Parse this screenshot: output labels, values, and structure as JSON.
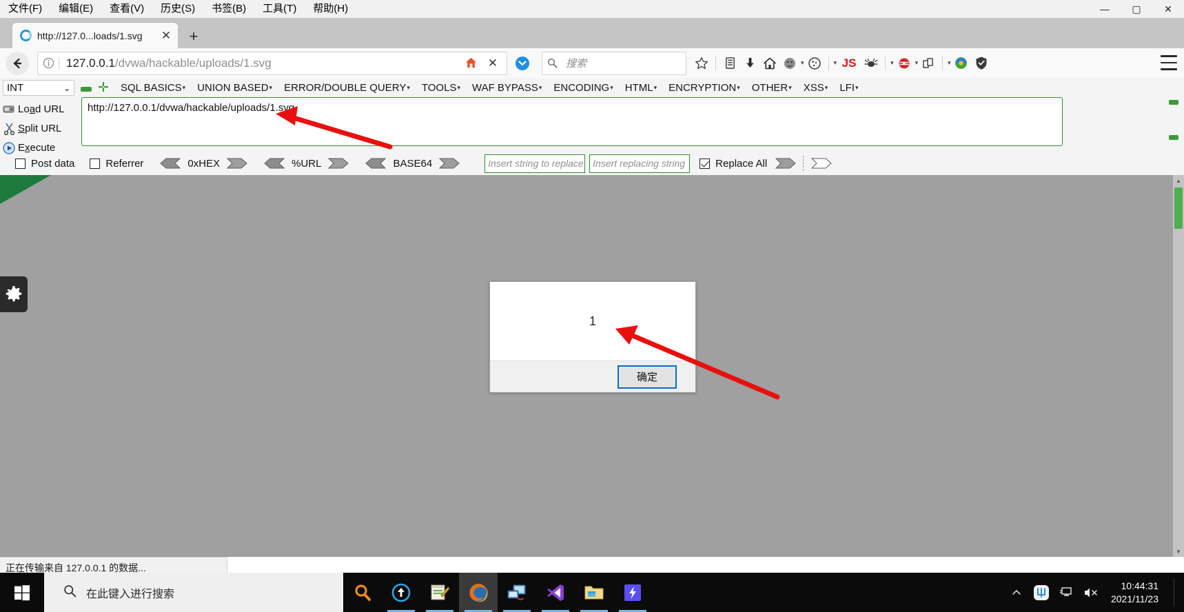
{
  "window": {
    "menus": [
      "文件(F)",
      "编辑(E)",
      "查看(V)",
      "历史(S)",
      "书签(B)",
      "工具(T)",
      "帮助(H)"
    ],
    "minimize": "—",
    "maximize": "▢",
    "close": "✕"
  },
  "tab": {
    "title": "http://127.0...loads/1.svg",
    "close": "✕",
    "newtab": "+"
  },
  "nav": {
    "back": "←",
    "info": "ⓘ",
    "url_host": "127.0.0.1",
    "url_path": "/dvwa/hackable/uploads/1.svg",
    "home_in_url": "🏠",
    "stop": "✕",
    "pocket": "▶",
    "search_placeholder": "搜索",
    "js_label": "JS",
    "toolbar_icons": [
      "star-icon",
      "library-icon",
      "downloads-icon",
      "home-icon",
      "useragent-icon",
      "cookie-icon",
      "js-icon",
      "bug-icon",
      "proxy-icon",
      "copy-icon",
      "shareaholic-icon",
      "shield-icon",
      "menu-icon"
    ]
  },
  "hackbar": {
    "select_value": "INT",
    "select_caret": "⌄",
    "minus": "",
    "plus": "✛",
    "menus": [
      "SQL BASICS",
      "UNION BASED",
      "ERROR/DOUBLE QUERY",
      "TOOLS",
      "WAF BYPASS",
      "ENCODING",
      "HTML",
      "ENCRYPTION",
      "OTHER",
      "XSS",
      "LFI"
    ],
    "actions": [
      {
        "label_pre": "Lo",
        "label_key": "a",
        "label_post": "d URL",
        "icon": "load-url-icon"
      },
      {
        "label_pre": "",
        "label_key": "S",
        "label_post": "plit URL",
        "icon": "split-url-icon"
      },
      {
        "label_pre": "E",
        "label_key": "x",
        "label_post": "ecute",
        "icon": "execute-icon"
      }
    ],
    "url_value": "http://127.0.0.1/dvwa/hackable/uploads/1.svg",
    "checkboxes": [
      {
        "label": "Post data",
        "checked": false
      },
      {
        "label": "Referrer",
        "checked": false
      }
    ],
    "encoders": [
      "0xHEX",
      "%URL",
      "BASE64"
    ],
    "replace_from_placeholder": "Insert string to replace",
    "replace_to_placeholder": "Insert replacing string",
    "replace_all_label": "Replace All",
    "replace_all_checked": true
  },
  "dialog": {
    "message": "1",
    "ok_label": "确定"
  },
  "status": {
    "text": "正在传输来自 127.0.0.1 的数据..."
  },
  "taskbar": {
    "search_placeholder": "在此键入进行搜索",
    "apps": [
      "search-app-icon",
      "everything-icon",
      "notepad-icon",
      "firefox-icon",
      "remote-desktop-icon",
      "vscode-icon",
      "file-explorer-icon",
      "burp-icon"
    ],
    "tray_icons": [
      "chevron-up-icon",
      "input-method-icon",
      "network-icon",
      "volume-muted-icon"
    ],
    "time": "10:44:31",
    "date": "2021/11/23"
  },
  "colors": {
    "hackbar_border": "#2e8b32",
    "dialog_accent": "#0b6bcb",
    "arrow_red": "#e8100f",
    "page_bg": "#a0a0a0"
  }
}
